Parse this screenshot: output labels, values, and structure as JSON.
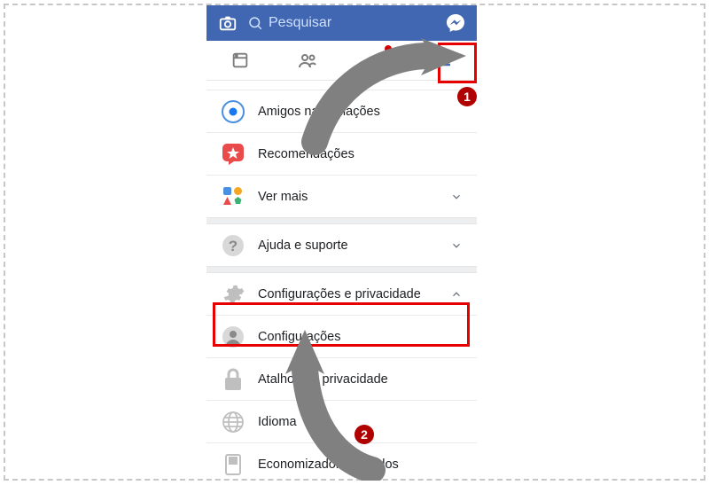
{
  "header": {
    "search_placeholder": "Pesquisar"
  },
  "menu": {
    "amigos": "Amigos nas     ediações",
    "recomendacoes": "Recomendações",
    "ver_mais": "Ver mais",
    "ajuda_suporte": "Ajuda e suporte",
    "config_privacidade": "Configurações e privacidade",
    "configuracoes": "Configurações",
    "atalhos_privacidade": "Atalhos de privacidade",
    "idioma": "Idioma",
    "economizador": "Economizador de Dados"
  },
  "annotations": {
    "badge1": "1",
    "badge2": "2"
  }
}
